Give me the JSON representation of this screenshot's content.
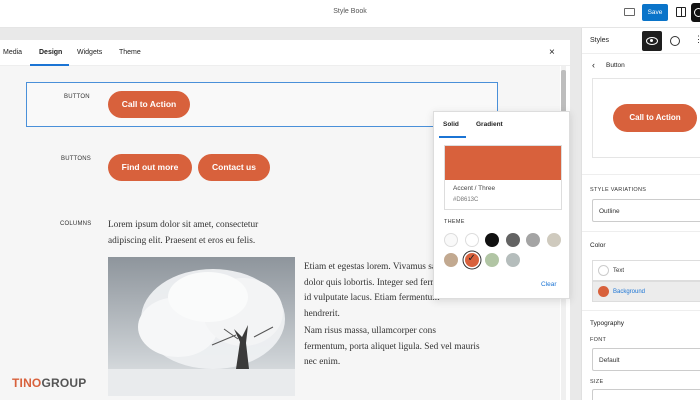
{
  "topbar": {
    "title": "Style Book",
    "save_label": "Save"
  },
  "canvas": {
    "tabs": [
      {
        "label": "Media"
      },
      {
        "label": "Design"
      },
      {
        "label": "Widgets"
      },
      {
        "label": "Theme"
      }
    ],
    "active_tab": "Design",
    "close_label": "×",
    "rows": {
      "button_label": "BUTTON",
      "buttons_label": "BUTTONS",
      "columns_label": "COLUMNS"
    },
    "button_text": "Call to Action",
    "buttons": [
      "Find out more",
      "Contact us"
    ],
    "column_left_text": "Lorem ipsum dolor sit amet, consectetur adipiscing elit. Praesent et eros eu felis.",
    "column_right_p1_lines": [
      "Etiam et egestas lorem. Vivamus sa",
      "dolor quis lobortis. Integer sed ferm",
      "id vulputate lacus. Etiam fermentum",
      "hendrerit."
    ],
    "column_right_p2_lines": [
      "Nam risus massa, ullamcorper cons",
      "fermentum, porta aliquet ligula. Sed vel mauris",
      "nec enim."
    ]
  },
  "popover": {
    "tabs": [
      "Solid",
      "Gradient"
    ],
    "active_tab": "Solid",
    "selected_color": "#D8613C",
    "color_name": "Accent / Three",
    "color_hex": "#D8613C",
    "theme_label": "THEME",
    "theme_colors": [
      "#f9f9f9",
      "#ffffff",
      "#111111",
      "#636363",
      "#a4a4a4",
      "#cfcabe",
      "#c2a990",
      "#d8613c",
      "#b1c5a4",
      "#b5bdbc"
    ],
    "clear_label": "Clear"
  },
  "sidebar": {
    "title": "Styles",
    "breadcrumb": "Button",
    "preview_button_text": "Call to Action",
    "style_variations_label": "STYLE VARIATIONS",
    "style_variations_value": "Outline",
    "color_section_label": "Color",
    "color_items": [
      {
        "label": "Text",
        "swatch": "#ffffff",
        "active": false
      },
      {
        "label": "Background",
        "swatch": "#d8613c",
        "active": true
      }
    ],
    "typography_label": "Typography",
    "font_label": "FONT",
    "font_value": "Default",
    "size_label": "SIZE"
  },
  "watermark": {
    "part1": "TINO",
    "part2": "GROUP"
  },
  "colors": {
    "accent": "#d8613c",
    "primary_blue": "#0a74c9"
  }
}
